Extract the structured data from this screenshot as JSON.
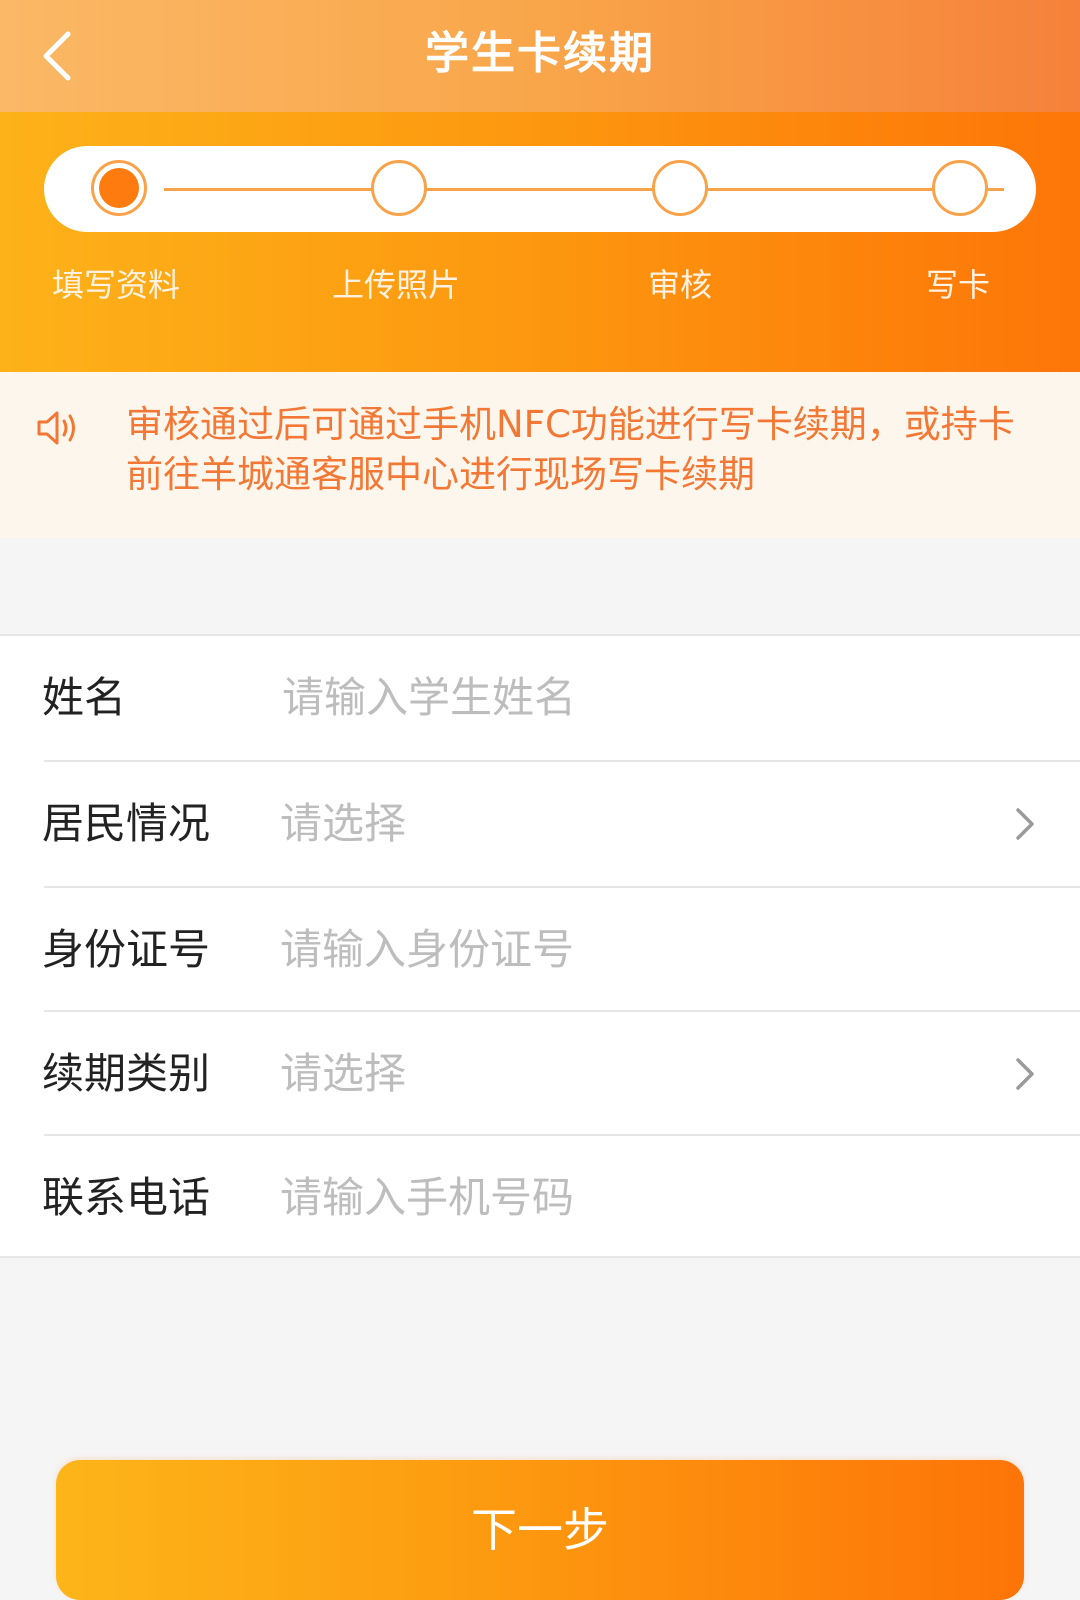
{
  "header": {
    "title": "学生卡续期",
    "back_icon": "chevron-left-icon"
  },
  "steps": {
    "current": 1,
    "items": [
      {
        "label": "填写资料"
      },
      {
        "label": "上传照片"
      },
      {
        "label": "审核"
      },
      {
        "label": "写卡"
      }
    ]
  },
  "notice": {
    "icon": "speaker-icon",
    "text": "审核通过后可通过手机NFC功能进行写卡续期，或持卡前往羊城通客服中心进行现场写卡续期"
  },
  "form": {
    "fields": [
      {
        "label": "姓名",
        "placeholder": "请输入学生姓名",
        "type": "text"
      },
      {
        "label": "居民情况",
        "placeholder": "请选择",
        "type": "select"
      },
      {
        "label": "身份证号",
        "placeholder": "请输入身份证号",
        "type": "text"
      },
      {
        "label": "续期类别",
        "placeholder": "请选择",
        "type": "select"
      },
      {
        "label": "联系电话",
        "placeholder": "请输入手机号码",
        "type": "text"
      }
    ]
  },
  "actions": {
    "next_label": "下一步"
  },
  "colors": {
    "accent": "#fd8a0c",
    "notice_text": "#f37835",
    "notice_bg": "#fdf6ec"
  }
}
